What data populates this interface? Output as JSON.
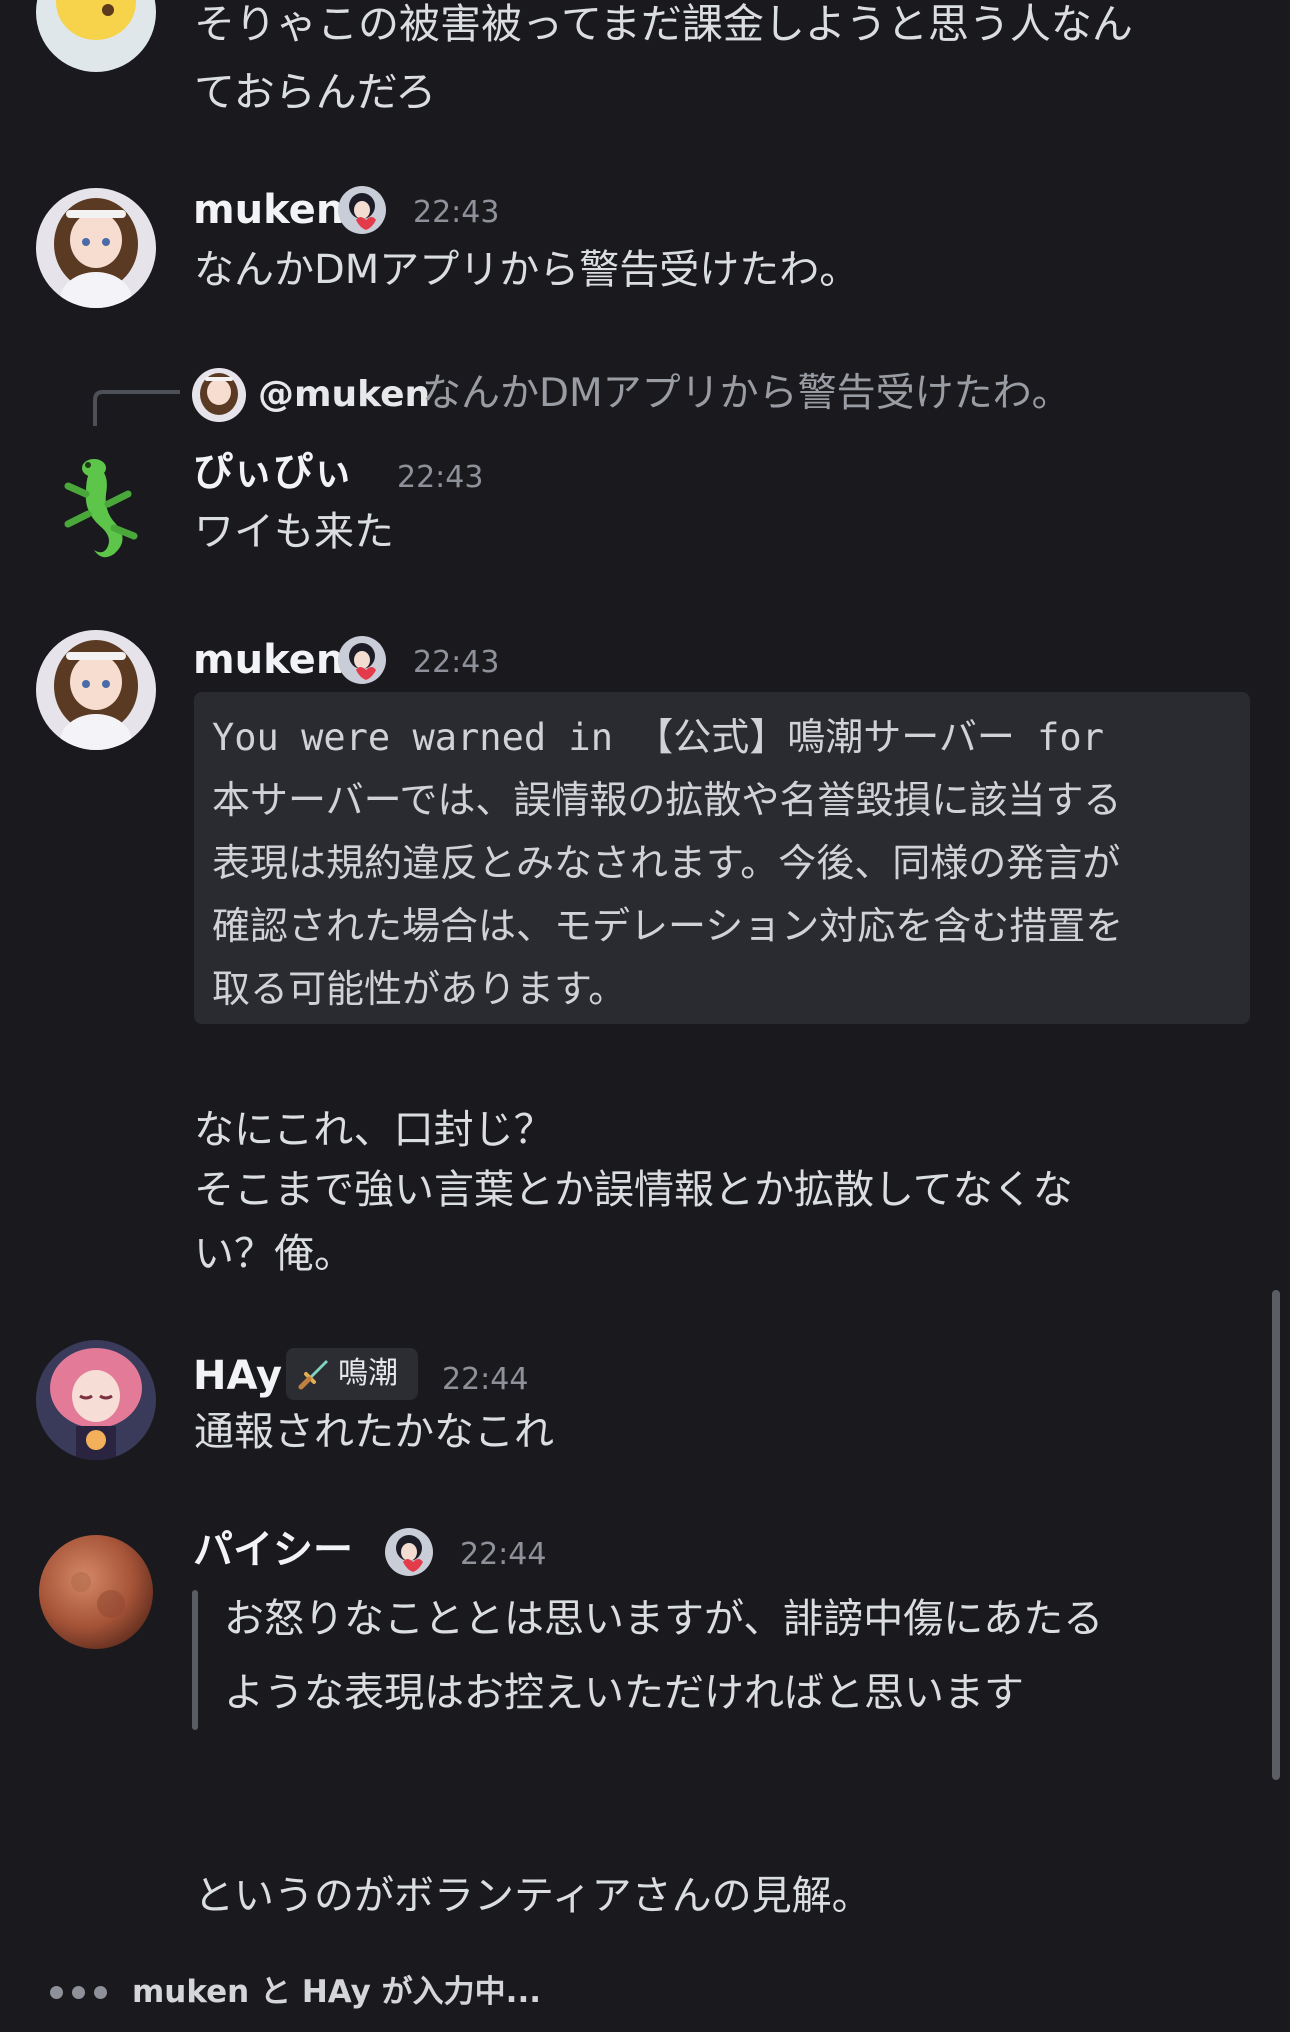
{
  "messages": {
    "m0": {
      "lines": [
        "そりゃこの被害被ってまだ課金しようと思う人なん",
        "ておらんだろ"
      ]
    },
    "m1": {
      "author": "muken",
      "time": "22:43",
      "text": "なんかDMアプリから警告受けたわ。"
    },
    "m2": {
      "reply_mention": "@muken",
      "reply_preview": "なんかDMアプリから警告受けたわ。",
      "author": "ぴぃぴぃ",
      "time": "22:43",
      "text": "ワイも来た"
    },
    "m3": {
      "author": "muken",
      "time": "22:43",
      "code_first": "You were warned in ",
      "code_server": "【公式】鳴潮サーバー",
      "code_for": " for",
      "code_lines": [
        "本サーバーでは、誤情報の拡散や名誉毀損に該当する",
        "表現は規約違反とみなされます。今後、同様の発言が",
        "確認された場合は、モデレーション対応を含む措置を",
        "取る可能性があります。"
      ],
      "followup": [
        "なにこれ、口封じ？",
        "そこまで強い言葉とか誤情報とか拡散してなくな",
        "い？俺。"
      ]
    },
    "m4": {
      "author": "HAy",
      "tag": "鳴潮",
      "time": "22:44",
      "text": "通報されたかなこれ"
    },
    "m5": {
      "author": "パイシー",
      "time": "22:44",
      "quote": [
        "お怒りなこととは思いますが、誹謗中傷にあたる",
        "ような表現はお控えいただければと思います"
      ],
      "followup": "というのがボランティアさんの見解。"
    }
  },
  "typing": {
    "text": "muken と HAy が入力中..."
  },
  "colors": {
    "background": "#1a1a1e",
    "text": "#dbdee1",
    "timestamp": "#8e9199",
    "codeblock": "#2a2b30"
  }
}
